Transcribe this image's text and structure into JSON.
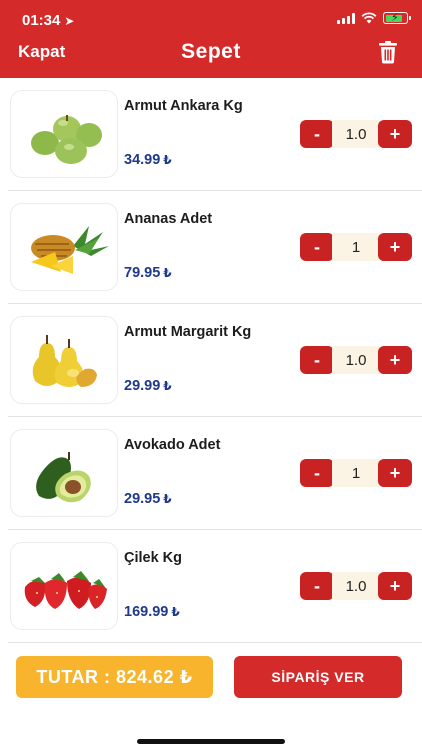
{
  "status_bar": {
    "time": "01:34"
  },
  "header": {
    "close_label": "Kapat",
    "title": "Sepet",
    "trash_icon": "trash-icon",
    "background": "#d42a2a"
  },
  "cart": {
    "currency": "₺",
    "items": [
      {
        "name": "Armut Ankara Kg",
        "price": "34.99",
        "quantity": "1.0",
        "image": "green-pears"
      },
      {
        "name": "Ananas Adet",
        "price": "79.95",
        "quantity": "1",
        "image": "pineapple"
      },
      {
        "name": "Armut Margarit Kg",
        "price": "29.99",
        "quantity": "1.0",
        "image": "yellow-pears"
      },
      {
        "name": "Avokado Adet",
        "price": "29.95",
        "quantity": "1",
        "image": "avocado"
      },
      {
        "name": "Çilek Kg",
        "price": "169.99",
        "quantity": "1.0",
        "image": "strawberries"
      }
    ],
    "minus_label": "-",
    "plus_label": "+"
  },
  "footer": {
    "total_label": "TUTAR : 824.62 ₺",
    "order_label": "SİPARİŞ VER",
    "total_color": "#f7b42c",
    "order_color": "#d42a2a"
  }
}
